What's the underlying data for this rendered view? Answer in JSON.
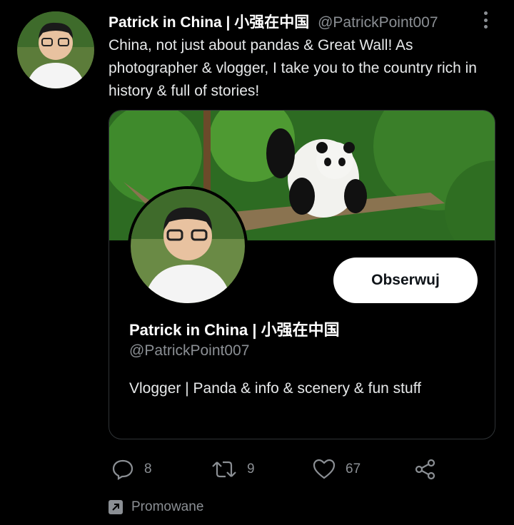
{
  "tweet": {
    "author_name": "Patrick in China | 小强在中国",
    "author_handle": "@PatrickPoint007",
    "text": "China, not just about pandas & Great Wall! As photographer & vlogger, I take you to the country rich in history & full of stories!"
  },
  "card": {
    "follow_label": "Obserwuj",
    "name": "Patrick in China | 小强在中国",
    "handle": "@PatrickPoint007",
    "bio": "Vlogger | Panda & info & scenery & fun stuff"
  },
  "actions": {
    "replies": "8",
    "retweets": "9",
    "likes": "67"
  },
  "promoted_label": "Promowane",
  "icons": [
    "more-vertical-icon",
    "reply-icon",
    "retweet-icon",
    "like-icon",
    "share-icon",
    "promoted-icon"
  ],
  "colors": {
    "background": "#000000",
    "muted": "#8b8f94",
    "button": "#ffffff"
  }
}
